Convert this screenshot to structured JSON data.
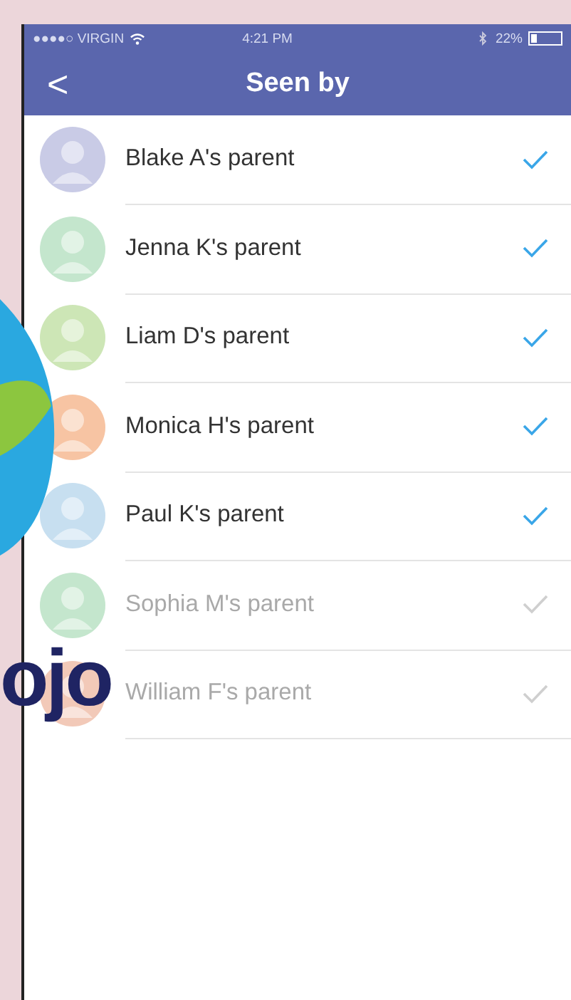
{
  "status_bar": {
    "carrier": "●●●●○ VIRGIN",
    "time": "4:21 PM",
    "battery": "22%"
  },
  "nav": {
    "back": "<",
    "title": "Seen by"
  },
  "parents": [
    {
      "name": "Blake A's parent",
      "seen": true,
      "color": "#c9cbe6"
    },
    {
      "name": "Jenna K's parent",
      "seen": true,
      "color": "#c4e6cd"
    },
    {
      "name": "Liam D's parent",
      "seen": true,
      "color": "#cde6b6"
    },
    {
      "name": "Monica H's parent",
      "seen": true,
      "color": "#f7c4a3"
    },
    {
      "name": "Paul K's parent",
      "seen": true,
      "color": "#c7dff0"
    },
    {
      "name": "Sophia M's parent",
      "seen": false,
      "color": "#c4e6cd"
    },
    {
      "name": "William F's parent",
      "seen": false,
      "color": "#f2c9b8"
    }
  ],
  "logo": {
    "text": "ojo"
  }
}
